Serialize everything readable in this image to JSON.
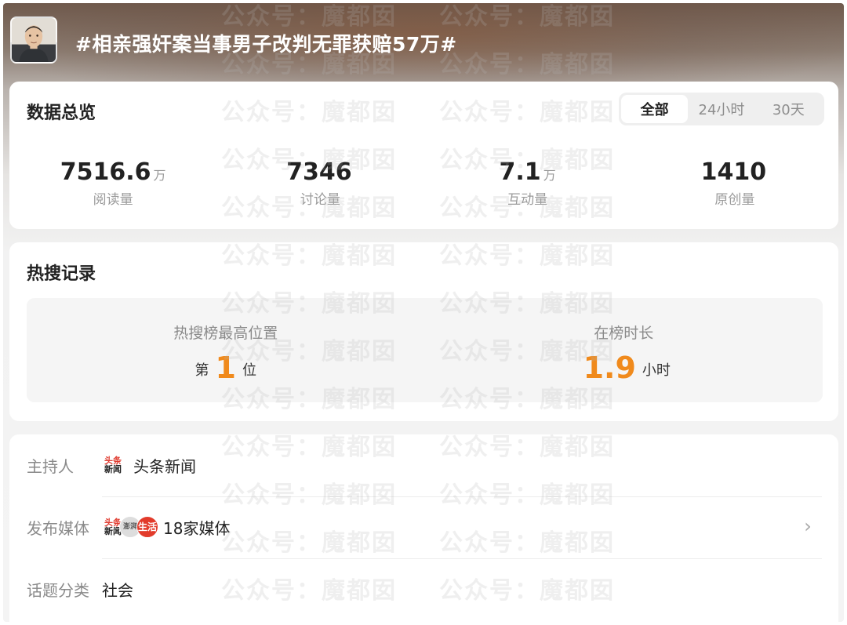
{
  "header": {
    "title": "#相亲强奸案当事男子改判无罪获赔57万#",
    "avatar_icon": "person-avatar"
  },
  "overview": {
    "title": "数据总览",
    "tabs": [
      {
        "label": "全部",
        "active": true
      },
      {
        "label": "24小时",
        "active": false
      },
      {
        "label": "30天",
        "active": false
      }
    ],
    "stats": [
      {
        "value": "7516.6",
        "unit": "万",
        "label": "阅读量"
      },
      {
        "value": "7346",
        "unit": "",
        "label": "讨论量"
      },
      {
        "value": "7.1",
        "unit": "万",
        "label": "互动量"
      },
      {
        "value": "1410",
        "unit": "",
        "label": "原创量"
      }
    ]
  },
  "hot_search": {
    "title": "热搜记录",
    "highest_position": {
      "label": "热搜榜最高位置",
      "prefix": "第",
      "value": "1",
      "suffix": "位"
    },
    "duration": {
      "label": "在榜时长",
      "value": "1.9",
      "suffix": "小时"
    },
    "accent_color": "#f08a1c"
  },
  "info": {
    "host": {
      "key": "主持人",
      "value": "头条新闻",
      "logo_text_top": "头条",
      "logo_text_bottom": "新闻"
    },
    "media": {
      "key": "发布媒体",
      "value": "18家媒体",
      "logos": [
        {
          "top": "头条",
          "bottom": "新闻"
        },
        {
          "top": "",
          "bottom": "澎湃"
        },
        {
          "top": "",
          "bottom": "生活"
        }
      ],
      "chevron_icon": "chevron-right-icon"
    },
    "category": {
      "key": "话题分类",
      "value": "社会"
    }
  },
  "watermark": {
    "text": "公众号：魔都囡"
  }
}
